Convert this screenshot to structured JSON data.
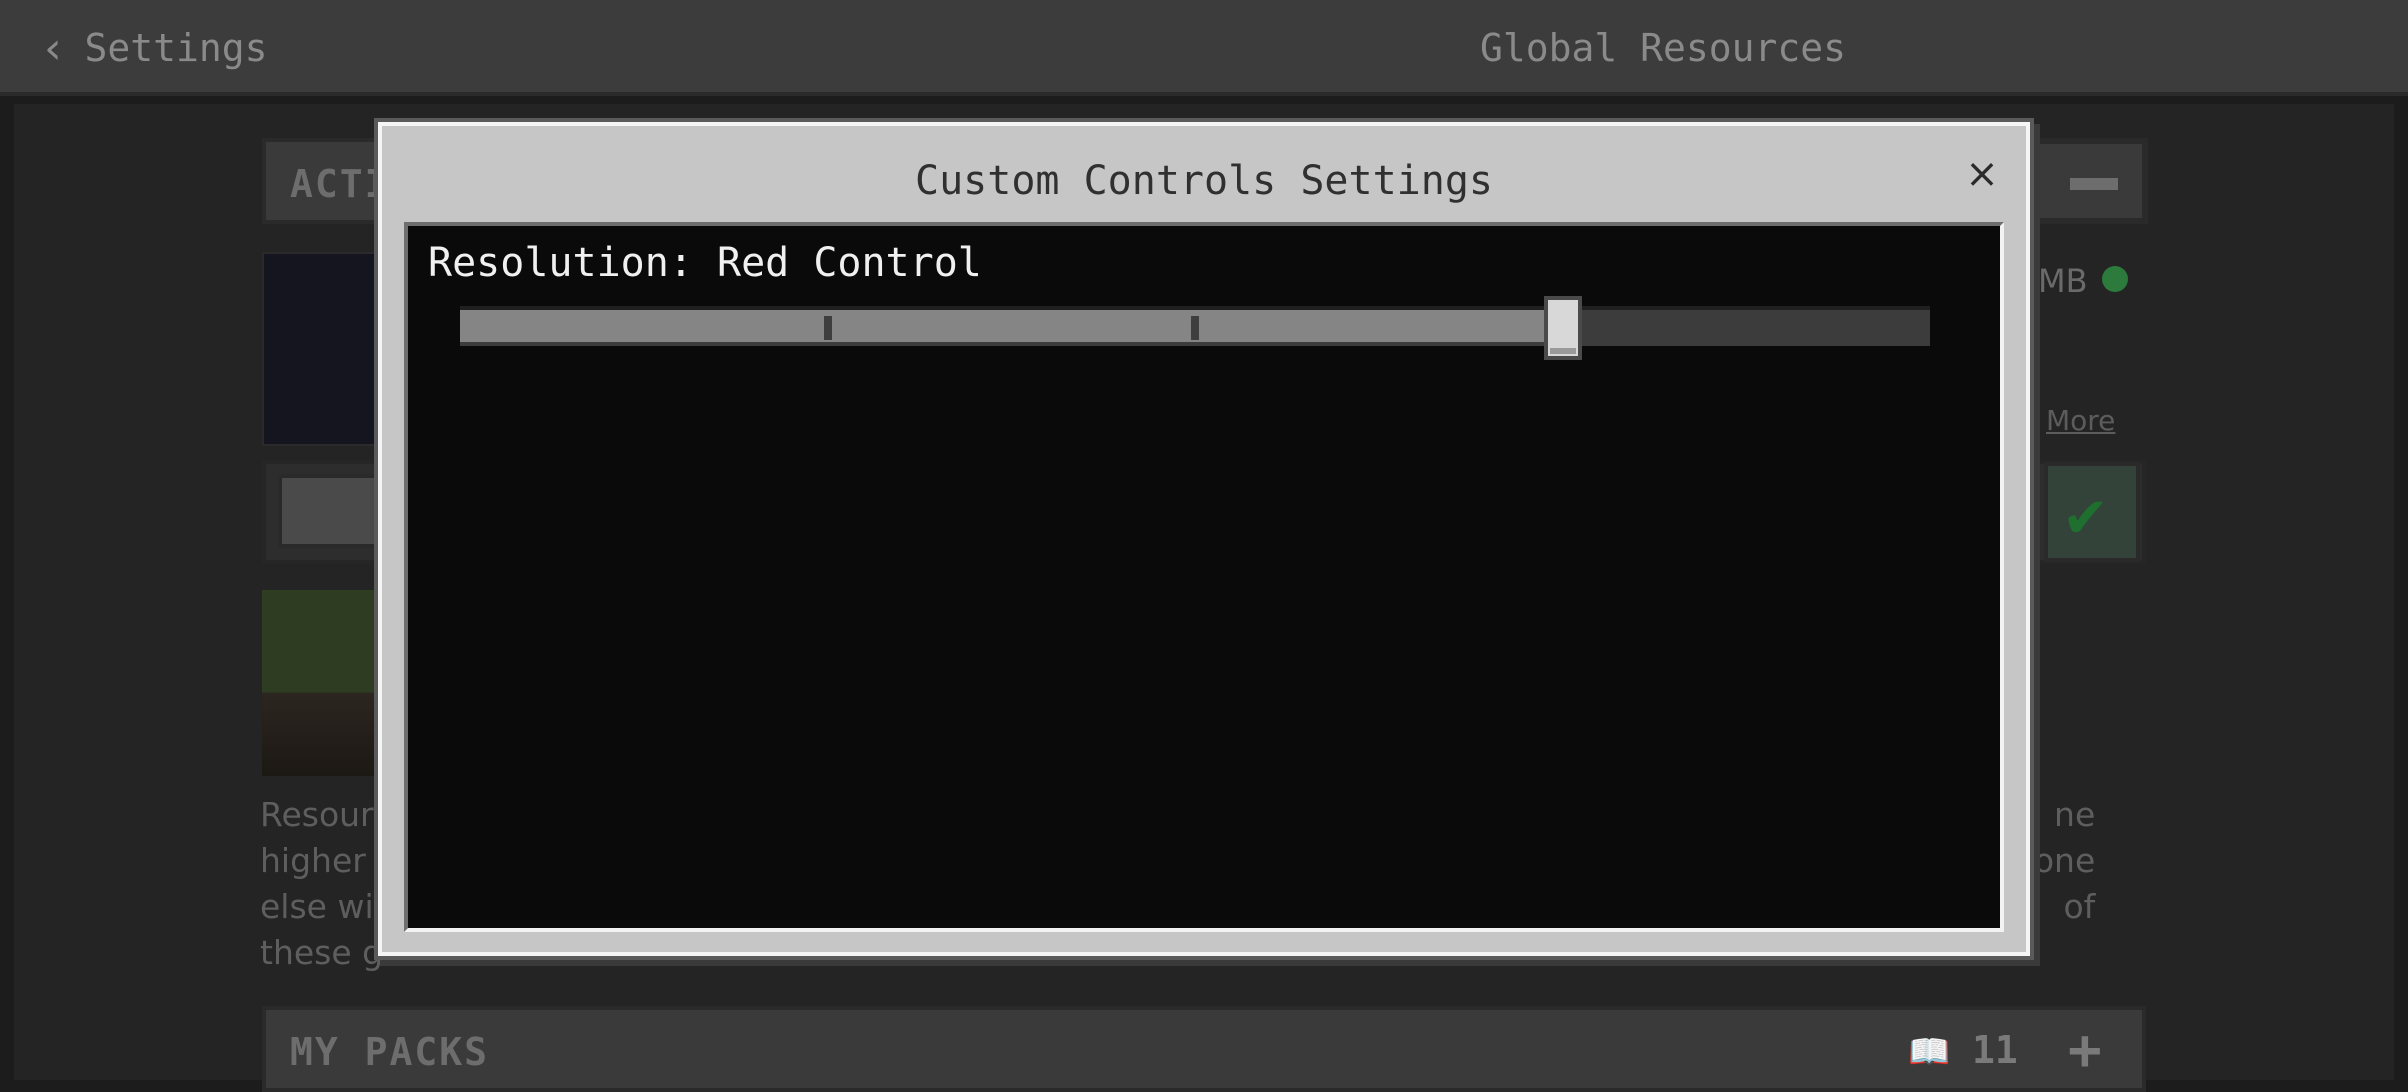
{
  "header": {
    "back_label": "Settings",
    "screen_title": "Global Resources"
  },
  "background": {
    "active_section_label": "ACTI",
    "size_text": "MB",
    "more_link": "More",
    "description_left": "Resour\nhigher\nelse wi\nthese g",
    "description_right": "ne\nlo one\nof",
    "my_packs_label": "MY PACKS",
    "my_packs_count": "11",
    "add_symbol": "+"
  },
  "dialog": {
    "title": "Custom Controls Settings",
    "close_symbol": "×",
    "slider": {
      "label": "Resolution: Red Control",
      "value_fraction": 0.75,
      "tick_fractions": [
        0.25,
        0.5
      ]
    }
  },
  "colors": {
    "status_dot": "#2c7a3c",
    "check": "#1f6f2f"
  },
  "icons": [
    "chevron-left-icon",
    "minus-icon",
    "checkmark-icon",
    "book-icon",
    "plus-icon",
    "close-icon"
  ]
}
